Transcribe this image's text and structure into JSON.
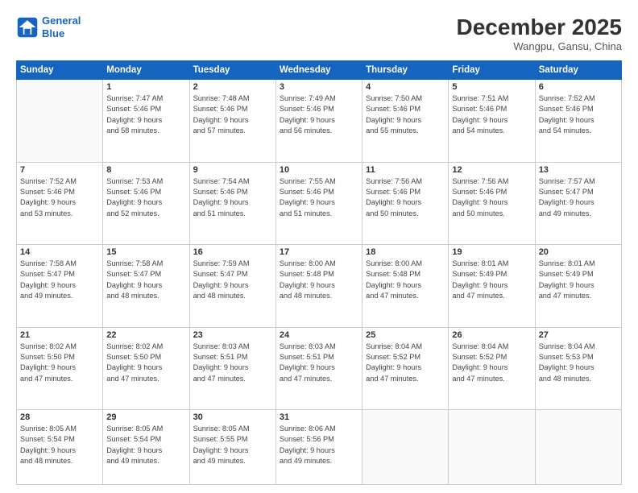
{
  "header": {
    "logo_line1": "General",
    "logo_line2": "Blue",
    "month": "December 2025",
    "location": "Wangpu, Gansu, China"
  },
  "weekdays": [
    "Sunday",
    "Monday",
    "Tuesday",
    "Wednesday",
    "Thursday",
    "Friday",
    "Saturday"
  ],
  "weeks": [
    [
      {
        "day": "",
        "sunrise": "",
        "sunset": "",
        "daylight": ""
      },
      {
        "day": "1",
        "sunrise": "Sunrise: 7:47 AM",
        "sunset": "Sunset: 5:46 PM",
        "daylight": "Daylight: 9 hours and 58 minutes."
      },
      {
        "day": "2",
        "sunrise": "Sunrise: 7:48 AM",
        "sunset": "Sunset: 5:46 PM",
        "daylight": "Daylight: 9 hours and 57 minutes."
      },
      {
        "day": "3",
        "sunrise": "Sunrise: 7:49 AM",
        "sunset": "Sunset: 5:46 PM",
        "daylight": "Daylight: 9 hours and 56 minutes."
      },
      {
        "day": "4",
        "sunrise": "Sunrise: 7:50 AM",
        "sunset": "Sunset: 5:46 PM",
        "daylight": "Daylight: 9 hours and 55 minutes."
      },
      {
        "day": "5",
        "sunrise": "Sunrise: 7:51 AM",
        "sunset": "Sunset: 5:46 PM",
        "daylight": "Daylight: 9 hours and 54 minutes."
      },
      {
        "day": "6",
        "sunrise": "Sunrise: 7:52 AM",
        "sunset": "Sunset: 5:46 PM",
        "daylight": "Daylight: 9 hours and 54 minutes."
      }
    ],
    [
      {
        "day": "7",
        "sunrise": "Sunrise: 7:52 AM",
        "sunset": "Sunset: 5:46 PM",
        "daylight": "Daylight: 9 hours and 53 minutes."
      },
      {
        "day": "8",
        "sunrise": "Sunrise: 7:53 AM",
        "sunset": "Sunset: 5:46 PM",
        "daylight": "Daylight: 9 hours and 52 minutes."
      },
      {
        "day": "9",
        "sunrise": "Sunrise: 7:54 AM",
        "sunset": "Sunset: 5:46 PM",
        "daylight": "Daylight: 9 hours and 51 minutes."
      },
      {
        "day": "10",
        "sunrise": "Sunrise: 7:55 AM",
        "sunset": "Sunset: 5:46 PM",
        "daylight": "Daylight: 9 hours and 51 minutes."
      },
      {
        "day": "11",
        "sunrise": "Sunrise: 7:56 AM",
        "sunset": "Sunset: 5:46 PM",
        "daylight": "Daylight: 9 hours and 50 minutes."
      },
      {
        "day": "12",
        "sunrise": "Sunrise: 7:56 AM",
        "sunset": "Sunset: 5:46 PM",
        "daylight": "Daylight: 9 hours and 50 minutes."
      },
      {
        "day": "13",
        "sunrise": "Sunrise: 7:57 AM",
        "sunset": "Sunset: 5:47 PM",
        "daylight": "Daylight: 9 hours and 49 minutes."
      }
    ],
    [
      {
        "day": "14",
        "sunrise": "Sunrise: 7:58 AM",
        "sunset": "Sunset: 5:47 PM",
        "daylight": "Daylight: 9 hours and 49 minutes."
      },
      {
        "day": "15",
        "sunrise": "Sunrise: 7:58 AM",
        "sunset": "Sunset: 5:47 PM",
        "daylight": "Daylight: 9 hours and 48 minutes."
      },
      {
        "day": "16",
        "sunrise": "Sunrise: 7:59 AM",
        "sunset": "Sunset: 5:47 PM",
        "daylight": "Daylight: 9 hours and 48 minutes."
      },
      {
        "day": "17",
        "sunrise": "Sunrise: 8:00 AM",
        "sunset": "Sunset: 5:48 PM",
        "daylight": "Daylight: 9 hours and 48 minutes."
      },
      {
        "day": "18",
        "sunrise": "Sunrise: 8:00 AM",
        "sunset": "Sunset: 5:48 PM",
        "daylight": "Daylight: 9 hours and 47 minutes."
      },
      {
        "day": "19",
        "sunrise": "Sunrise: 8:01 AM",
        "sunset": "Sunset: 5:49 PM",
        "daylight": "Daylight: 9 hours and 47 minutes."
      },
      {
        "day": "20",
        "sunrise": "Sunrise: 8:01 AM",
        "sunset": "Sunset: 5:49 PM",
        "daylight": "Daylight: 9 hours and 47 minutes."
      }
    ],
    [
      {
        "day": "21",
        "sunrise": "Sunrise: 8:02 AM",
        "sunset": "Sunset: 5:50 PM",
        "daylight": "Daylight: 9 hours and 47 minutes."
      },
      {
        "day": "22",
        "sunrise": "Sunrise: 8:02 AM",
        "sunset": "Sunset: 5:50 PM",
        "daylight": "Daylight: 9 hours and 47 minutes."
      },
      {
        "day": "23",
        "sunrise": "Sunrise: 8:03 AM",
        "sunset": "Sunset: 5:51 PM",
        "daylight": "Daylight: 9 hours and 47 minutes."
      },
      {
        "day": "24",
        "sunrise": "Sunrise: 8:03 AM",
        "sunset": "Sunset: 5:51 PM",
        "daylight": "Daylight: 9 hours and 47 minutes."
      },
      {
        "day": "25",
        "sunrise": "Sunrise: 8:04 AM",
        "sunset": "Sunset: 5:52 PM",
        "daylight": "Daylight: 9 hours and 47 minutes."
      },
      {
        "day": "26",
        "sunrise": "Sunrise: 8:04 AM",
        "sunset": "Sunset: 5:52 PM",
        "daylight": "Daylight: 9 hours and 47 minutes."
      },
      {
        "day": "27",
        "sunrise": "Sunrise: 8:04 AM",
        "sunset": "Sunset: 5:53 PM",
        "daylight": "Daylight: 9 hours and 48 minutes."
      }
    ],
    [
      {
        "day": "28",
        "sunrise": "Sunrise: 8:05 AM",
        "sunset": "Sunset: 5:54 PM",
        "daylight": "Daylight: 9 hours and 48 minutes."
      },
      {
        "day": "29",
        "sunrise": "Sunrise: 8:05 AM",
        "sunset": "Sunset: 5:54 PM",
        "daylight": "Daylight: 9 hours and 49 minutes."
      },
      {
        "day": "30",
        "sunrise": "Sunrise: 8:05 AM",
        "sunset": "Sunset: 5:55 PM",
        "daylight": "Daylight: 9 hours and 49 minutes."
      },
      {
        "day": "31",
        "sunrise": "Sunrise: 8:06 AM",
        "sunset": "Sunset: 5:56 PM",
        "daylight": "Daylight: 9 hours and 49 minutes."
      },
      {
        "day": "",
        "sunrise": "",
        "sunset": "",
        "daylight": ""
      },
      {
        "day": "",
        "sunrise": "",
        "sunset": "",
        "daylight": ""
      },
      {
        "day": "",
        "sunrise": "",
        "sunset": "",
        "daylight": ""
      }
    ]
  ]
}
